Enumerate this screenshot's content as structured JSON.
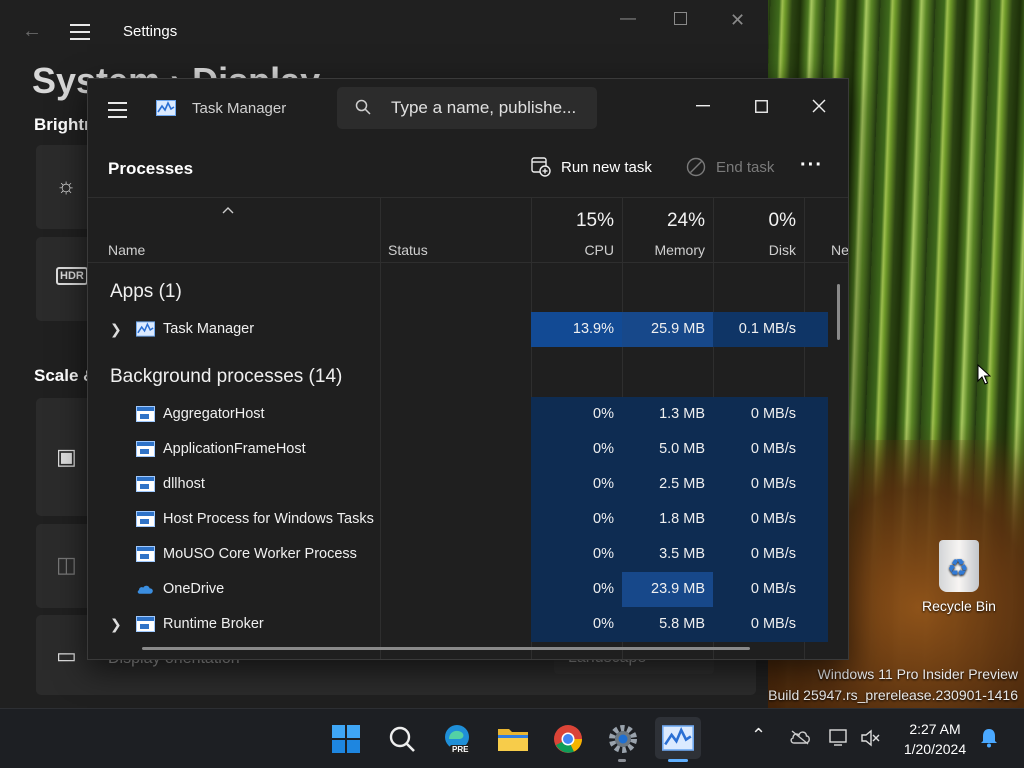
{
  "desktop": {
    "recycle_bin_label": "Recycle Bin",
    "watermark_line1": "Windows 11 Pro Insider Preview",
    "watermark_line2": "Build 25947.rs_prerelease.230901-1416"
  },
  "settings": {
    "app_title": "Settings",
    "breadcrumb": "System  ›  Display",
    "section_brightness": "Brightness",
    "section_scale": "Scale & layout",
    "display_orientation_label": "Display orientation",
    "display_orientation_value": "Landscape"
  },
  "task_manager": {
    "title": "Task Manager",
    "search_placeholder": "Type a name, publishe...",
    "page_title": "Processes",
    "run_new_task": "Run new task",
    "end_task": "End task",
    "columns": {
      "name": "Name",
      "status": "Status",
      "cpu_pct": "15%",
      "cpu": "CPU",
      "mem_pct": "24%",
      "mem": "Memory",
      "disk_pct": "0%",
      "disk": "Disk",
      "net": "Ne"
    },
    "groups": {
      "apps": "Apps (1)",
      "background": "Background processes (14)"
    },
    "apps": [
      {
        "name": "Task Manager",
        "cpu": "13.9%",
        "mem": "25.9 MB",
        "disk": "0.1 MB/s"
      }
    ],
    "background": [
      {
        "name": "AggregatorHost",
        "cpu": "0%",
        "mem": "1.3 MB",
        "disk": "0 MB/s"
      },
      {
        "name": "ApplicationFrameHost",
        "cpu": "0%",
        "mem": "5.0 MB",
        "disk": "0 MB/s"
      },
      {
        "name": "dllhost",
        "cpu": "0%",
        "mem": "2.5 MB",
        "disk": "0 MB/s"
      },
      {
        "name": "Host Process for Windows Tasks",
        "cpu": "0%",
        "mem": "1.8 MB",
        "disk": "0 MB/s"
      },
      {
        "name": "MoUSO Core Worker Process",
        "cpu": "0%",
        "mem": "3.5 MB",
        "disk": "0 MB/s"
      },
      {
        "name": "OneDrive",
        "cpu": "0%",
        "mem": "23.9 MB",
        "disk": "0 MB/s"
      },
      {
        "name": "Runtime Broker",
        "cpu": "0%",
        "mem": "5.8 MB",
        "disk": "0 MB/s"
      }
    ]
  },
  "taskbar": {
    "time": "2:27 AM",
    "date": "1/20/2024",
    "edge_badge": "PRE"
  },
  "colors": {
    "accent_blue": "#0f3566",
    "window_bg": "#1f1f1f",
    "taskbar_bg": "#1d1f23"
  }
}
